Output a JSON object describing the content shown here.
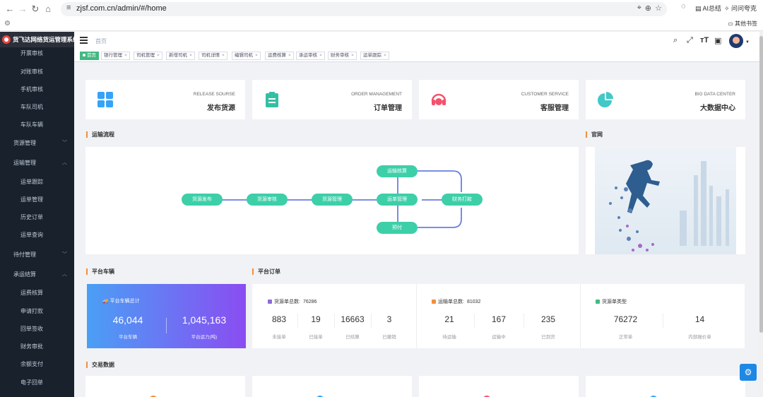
{
  "browser": {
    "url": "zjsf.com.cn/admin/#/home",
    "ext_ai": "AI总结",
    "ext_ask": "问问夸克",
    "bookmarks_folder": "其他书签"
  },
  "sidebar": {
    "title": "货飞达网络货运管理系统",
    "items": [
      {
        "label": "开票审核",
        "type": "sub"
      },
      {
        "label": "对账审核",
        "type": "sub"
      },
      {
        "label": "手机审核",
        "type": "sub"
      },
      {
        "label": "车队司机",
        "type": "sub"
      },
      {
        "label": "车队车辆",
        "type": "sub"
      },
      {
        "label": "货源管理",
        "type": "group",
        "state": "collapsed"
      },
      {
        "label": "运输管理",
        "type": "group",
        "state": "expanded"
      },
      {
        "label": "运单跟踪",
        "type": "sub"
      },
      {
        "label": "运单管理",
        "type": "sub"
      },
      {
        "label": "历史订单",
        "type": "sub"
      },
      {
        "label": "运单查询",
        "type": "sub"
      },
      {
        "label": "待付管理",
        "type": "group",
        "state": "collapsed"
      },
      {
        "label": "承运结算",
        "type": "group",
        "state": "expanded"
      },
      {
        "label": "运费核算",
        "type": "sub"
      },
      {
        "label": "申请打款",
        "type": "sub"
      },
      {
        "label": "回单签收",
        "type": "sub"
      },
      {
        "label": "财务审批",
        "type": "sub"
      },
      {
        "label": "余额支付",
        "type": "sub"
      },
      {
        "label": "电子回单",
        "type": "sub"
      }
    ]
  },
  "header": {
    "breadcrumb": "首页",
    "icons": [
      "search-icon",
      "fullscreen-icon",
      "font-size-icon",
      "layout-size-icon"
    ]
  },
  "tags": [
    {
      "label": "首页",
      "active": true
    },
    {
      "label": "银行管理",
      "active": false
    },
    {
      "label": "司机管理",
      "active": false
    },
    {
      "label": "新增司机",
      "active": false
    },
    {
      "label": "司机详情",
      "active": false
    },
    {
      "label": "编辑司机",
      "active": false
    },
    {
      "label": "运费核算",
      "active": false
    },
    {
      "label": "承运审核",
      "active": false
    },
    {
      "label": "财务审核",
      "active": false
    },
    {
      "label": "运单跟踪",
      "active": false
    }
  ],
  "panels": [
    {
      "en": "RELEASE SOURSE",
      "cn": "发布货源",
      "icon": "grid-icon",
      "color": "#36a3f7"
    },
    {
      "en": "ORDER MANAGEMENT",
      "cn": "订单管理",
      "icon": "clipboard-icon",
      "color": "#34bfa3"
    },
    {
      "en": "CUSTOMER SERVICE",
      "cn": "客服管理",
      "icon": "headset-icon",
      "color": "#f4516c"
    },
    {
      "en": "BIG DATA CENTER",
      "cn": "大数据中心",
      "icon": "pie-chart-icon",
      "color": "#40c9c6"
    }
  ],
  "sections": {
    "flow": "运输流程",
    "website": "官网",
    "vehicles": "平台车辆",
    "orders": "平台订单",
    "trade": "交易数据"
  },
  "flow_nodes": [
    "货源发布",
    "货源审核",
    "货源管理",
    "运输核算",
    "运单管理",
    "预付",
    "财务打款"
  ],
  "vehicles": {
    "title": "平台车辆总计",
    "count": "46,044",
    "count_label": "平台车辆",
    "capacity": "1,045,163",
    "capacity_label": "平台运力(吨)"
  },
  "orders": {
    "source": {
      "title": "货源单总数:",
      "total": "76286",
      "color": "#8a6bd9",
      "stats": [
        {
          "value": "883",
          "label": "未接单"
        },
        {
          "value": "19",
          "label": "已接单"
        },
        {
          "value": "16663",
          "label": "已结算"
        },
        {
          "value": "3",
          "label": "已撤销"
        }
      ]
    },
    "waybill": {
      "title": "运输单总数:",
      "total": "81032",
      "color": "#f18f3b",
      "stats": [
        {
          "value": "21",
          "label": "待运输"
        },
        {
          "value": "167",
          "label": "运输中"
        },
        {
          "value": "235",
          "label": "已到货"
        }
      ]
    },
    "source_type": {
      "title": "货源单类型",
      "color": "#42b983",
      "stats": [
        {
          "value": "76272",
          "label": "正常单"
        },
        {
          "value": "14",
          "label": "内部报价单"
        }
      ]
    }
  },
  "trade_icon_colors": [
    "#f18f3b",
    "#36a3f7",
    "#f4516c",
    "#36a3f7"
  ]
}
